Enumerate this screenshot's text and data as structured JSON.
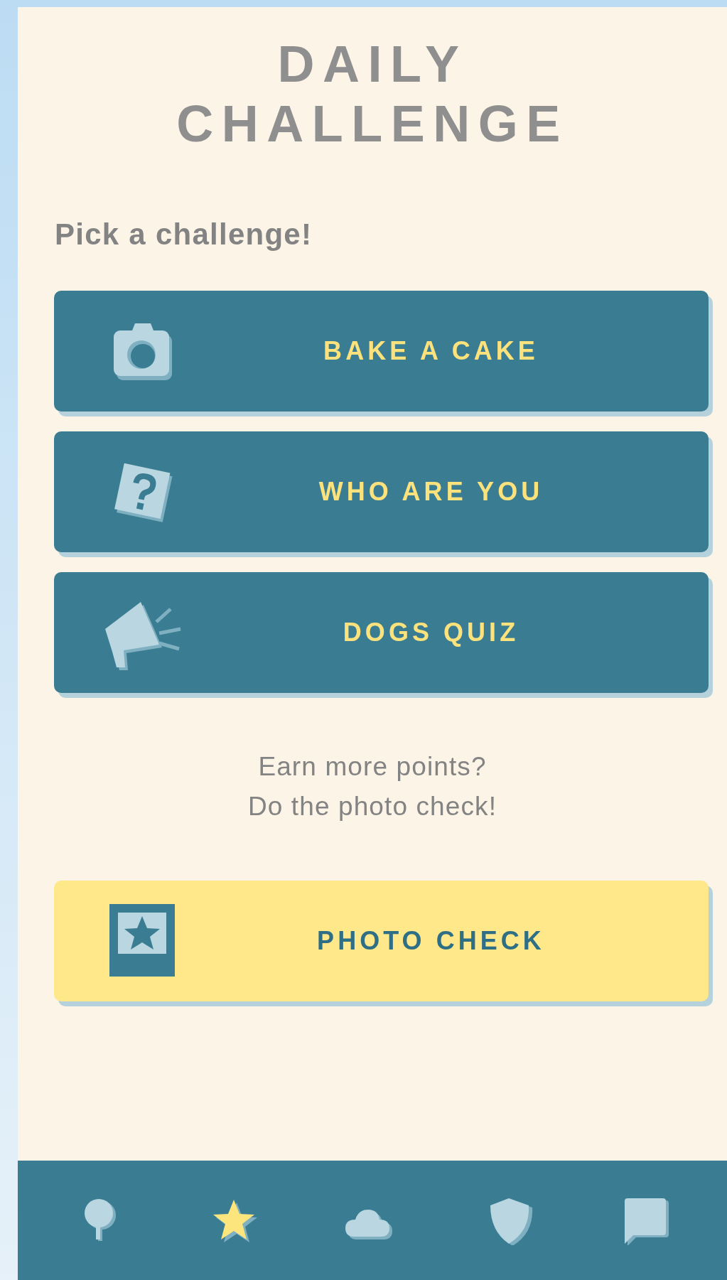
{
  "title": [
    "DAILY",
    "CHALLENGE"
  ],
  "prompt": "Pick a challenge!",
  "challenges": [
    {
      "label": "BAKE A CAKE"
    },
    {
      "label": "WHO ARE YOU"
    },
    {
      "label": "DOGS QUIZ"
    }
  ],
  "hint": [
    "Earn more points?",
    "Do the photo check!"
  ],
  "photo_check_button": {
    "label": "PHOTO CHECK"
  },
  "nav": [
    {
      "selected": false
    },
    {
      "selected": true
    },
    {
      "selected": false
    },
    {
      "selected": false
    },
    {
      "selected": false
    }
  ]
}
